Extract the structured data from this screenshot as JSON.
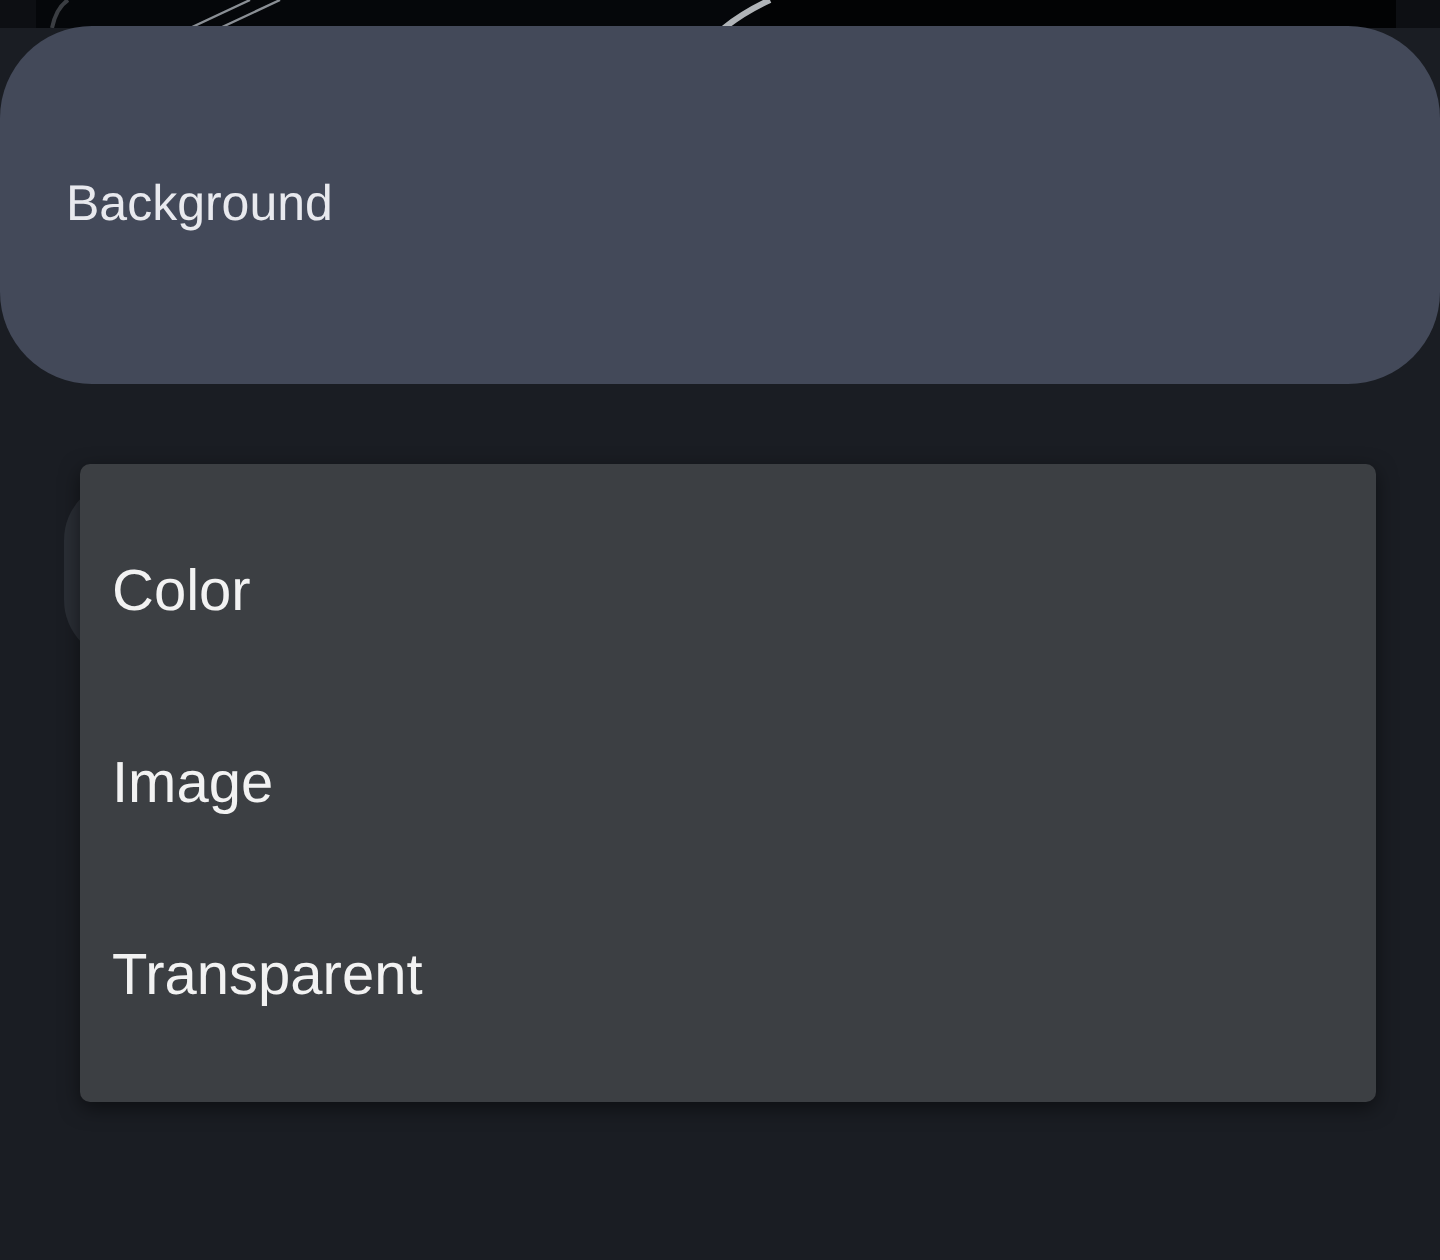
{
  "header": {
    "title": "Background"
  },
  "menu": {
    "items": [
      {
        "label": "Color"
      },
      {
        "label": "Image"
      },
      {
        "label": "Transparent"
      }
    ]
  }
}
